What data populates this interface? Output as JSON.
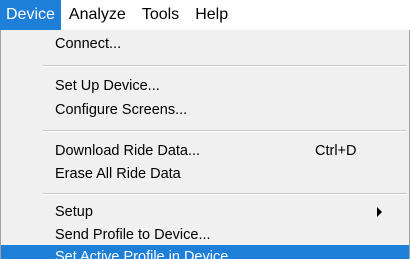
{
  "menubar": {
    "items": [
      "Device",
      "Analyze",
      "Tools",
      "Help"
    ]
  },
  "menu": {
    "connect": "Connect...",
    "set_up_device": "Set Up Device...",
    "configure_screens": "Configure Screens...",
    "download_ride_data": "Download Ride Data...",
    "download_shortcut": "Ctrl+D",
    "erase_ride_data": "Erase All Ride Data",
    "setup": "Setup",
    "send_profile": "Send Profile to Device...",
    "set_active_profile": "Set Active Profile in Device..."
  },
  "colors": {
    "highlight": "#1e7fd8"
  }
}
